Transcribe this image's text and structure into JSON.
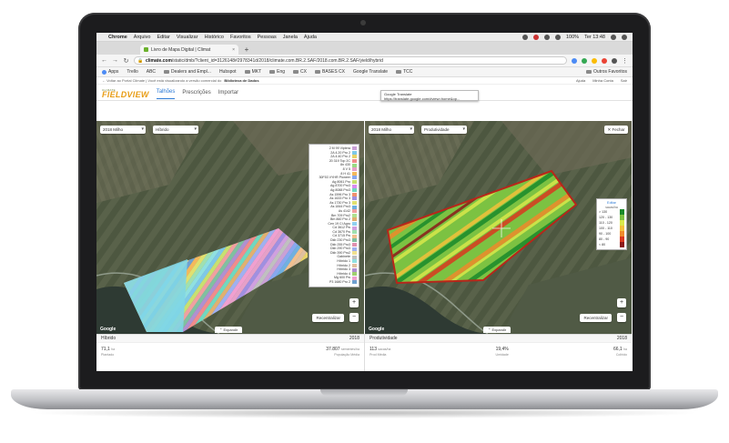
{
  "menubar": {
    "apple": "",
    "app": "Chrome",
    "items": [
      "Arquivo",
      "Editar",
      "Visualizar",
      "Histórico",
      "Favoritos",
      "Pessoas",
      "Janela",
      "Ajuda"
    ],
    "battery": "100%",
    "clock": "Ter 13:48"
  },
  "browser": {
    "tab_title": "Livro de Mapa Digital | Climat",
    "new_tab": "+",
    "url_domain": "climate.com",
    "url_path": "/static/dmb/?client_id=3126148#2978341d/2018/climate.com.BR.2.SAF/2018.com.BR.2.SAF/yield/hybrid",
    "bookmarks": [
      "Apps",
      "Trello",
      "ABC",
      "Dealers and Empl...",
      "Hubspot",
      "MKT",
      "Eng",
      "CX",
      "BASES CX",
      "Google Translate",
      "TCC"
    ],
    "other_bookmarks": "Outros Favoritos",
    "tooltip_title": "Google Translate",
    "tooltip_url": "https://translate.google.com/#view=home&op..."
  },
  "notice": {
    "prefix": "← Voltar ao Portal Climate | Você está visualizando a versão comercial do",
    "bold": "Biblioteca de Dados",
    "links": [
      "Ajuda",
      "Minha Conta",
      "Sair"
    ]
  },
  "app": {
    "logo_small": "CLIMATE",
    "logo_big": "FIELDVIEW",
    "tabs": [
      "Talhões",
      "Prescrições",
      "Importar"
    ]
  },
  "left_map": {
    "season": "2018 Milho",
    "layer": "Híbrido",
    "legend": [
      {
        "label": "2 M 99 Viptera",
        "color": "#c9a0d6"
      },
      {
        "label": "2A 4.20 Pro 2",
        "color": "#7ec8e8"
      },
      {
        "label": "2A 4.40 Pro 2",
        "color": "#e8d36a"
      },
      {
        "label": "20 319 Top 2C",
        "color": "#f08c8c"
      },
      {
        "label": "8n 430",
        "color": "#9adb85"
      },
      {
        "label": "8 V 5",
        "color": "#e6a0c8"
      },
      {
        "label": "8 H 41",
        "color": "#f4b85c"
      },
      {
        "label": "30F53 VYHR Pioneer",
        "color": "#88a8f0"
      },
      {
        "label": "Ag 8061 Pro",
        "color": "#c8e070"
      },
      {
        "label": "Ag 8700 Pro3",
        "color": "#d98cf0"
      },
      {
        "label": "Ag 8088 Pro3",
        "color": "#70d8c0"
      },
      {
        "label": "As 1596 Pro 3",
        "color": "#f09070"
      },
      {
        "label": "As 1633 Pro 3",
        "color": "#a090e0"
      },
      {
        "label": "As 1730 Pro 3",
        "color": "#e0e070"
      },
      {
        "label": "As 1844 Pro3",
        "color": "#70b0e0"
      },
      {
        "label": "As 4142",
        "color": "#f0a0a0"
      },
      {
        "label": "Bm 709 Pro2",
        "color": "#b0e090"
      },
      {
        "label": "Bm 860 Pro 2",
        "color": "#e0b070"
      },
      {
        "label": "Cen 19 CI Agro",
        "color": "#90d0f0"
      },
      {
        "label": "Cd 3612 Pw",
        "color": "#d0a0e0"
      },
      {
        "label": "Cd 3670 Pw",
        "color": "#a0e0b0"
      },
      {
        "label": "Cd 3715 Pw",
        "color": "#f0c090"
      },
      {
        "label": "Dkb 230 Pro3",
        "color": "#80c0a0"
      },
      {
        "label": "Dkb 255 Pro3",
        "color": "#e090b0"
      },
      {
        "label": "Dkb 290 Pro3",
        "color": "#a0b0f0"
      },
      {
        "label": "Dkb 390 Pro2",
        "color": "#f0e090"
      },
      {
        "label": "Gabinete",
        "color": "#c0c0c0"
      },
      {
        "label": "Híbrido 1",
        "color": "#90e0e0"
      },
      {
        "label": "Híbrido 2",
        "color": "#e0c0a0"
      },
      {
        "label": "Híbrido 3",
        "color": "#b090d0"
      },
      {
        "label": "Híbrido 4",
        "color": "#a0d070"
      },
      {
        "label": "Mg 600 Pw",
        "color": "#f0a0d0"
      },
      {
        "label": "P3 1680 Pro 2",
        "color": "#70a0d0"
      }
    ],
    "recenter": "Recentralizar",
    "google": "Google",
    "expand": "⌃ Expandir"
  },
  "right_map": {
    "season": "2018 Milho",
    "layer": "Produtividade",
    "close": "✕ Fechar",
    "legend_title": "Editar",
    "legend_unit": "sacas/ha",
    "legend": [
      {
        "label": "> 130",
        "color": "#1a8a2a"
      },
      {
        "label": "120 - 130",
        "color": "#7cc242"
      },
      {
        "label": "110 - 120",
        "color": "#d8e84a"
      },
      {
        "label": "100 - 110",
        "color": "#f3c13a"
      },
      {
        "label": "90 - 100",
        "color": "#ef8a2a"
      },
      {
        "label": "80 - 90",
        "color": "#d9381e"
      },
      {
        "label": "< 80",
        "color": "#8b1a1a"
      }
    ],
    "recenter": "Recentralizar",
    "google": "Google",
    "expand": "⌃ Expandir"
  },
  "left_panel": {
    "title": "Híbrido",
    "year": "2018",
    "stat1_value": "71,1",
    "stat1_unit": "ha",
    "stat1_label": "Plantado",
    "stat2_value": "37.807",
    "stat2_unit": "sementes/ha",
    "stat2_label": "População Média"
  },
  "right_panel": {
    "title": "Produtividade",
    "year": "2018",
    "stat1_value": "113",
    "stat1_unit": "sacas/ha",
    "stat1_label": "Prod Média",
    "stat2_value": "19,4%",
    "stat2_label": "Umidade",
    "stat3_value": "66,1",
    "stat3_unit": "ha",
    "stat3_label": "Colhido"
  },
  "colors": {
    "accent": "#2e7bd6",
    "logo": "#e89d16"
  }
}
